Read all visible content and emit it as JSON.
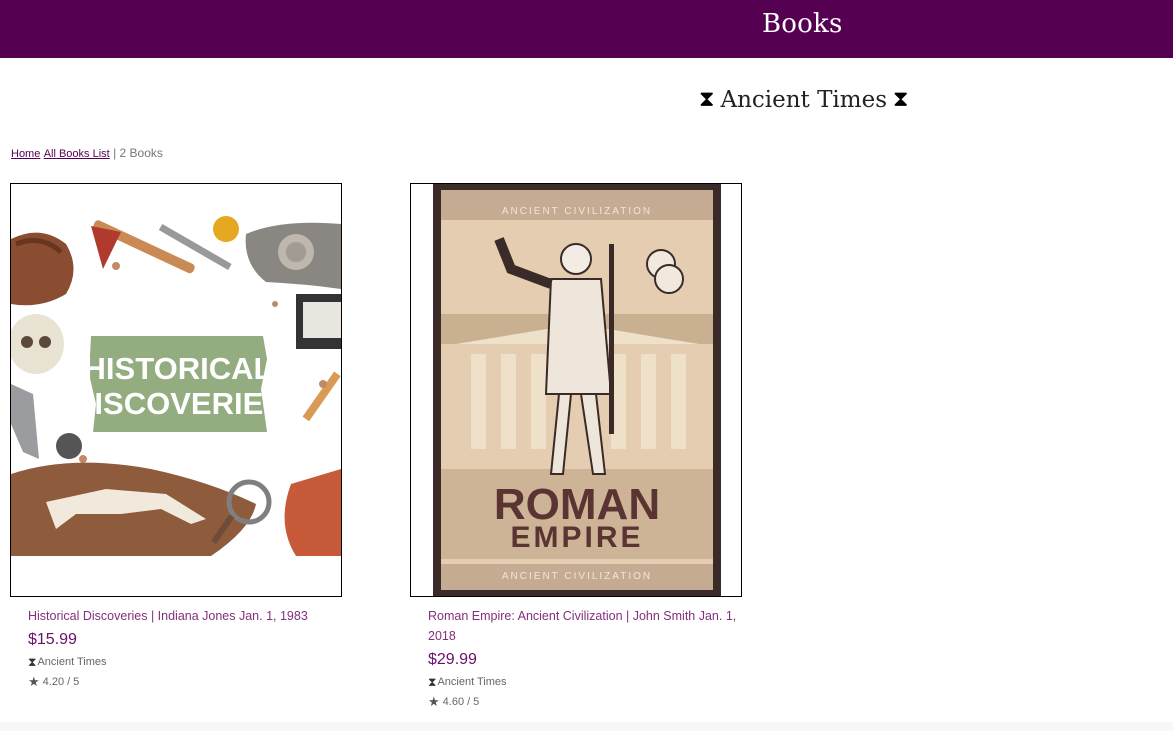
{
  "header": {
    "brand": "Books"
  },
  "category": {
    "title": "Ancient Times",
    "icon": "hourglass-icon"
  },
  "breadcrumb": {
    "home_link": "Home",
    "all_books_link": "All Books List",
    "separator": "|",
    "count": "2 Books"
  },
  "books": [
    {
      "title": "Historical Discoveries | Indiana Jones Jan. 1, 1983",
      "price": "$15.99",
      "category": "Ancient Times",
      "rating": "4.20",
      "rating_max": "5",
      "cover_text": [
        "HISTORICAL",
        "DISCOVERIES"
      ]
    },
    {
      "title": "Roman Empire: Ancient Civilization | John Smith Jan. 1, 2018",
      "price": "$29.99",
      "category": "Ancient Times",
      "rating": "4.60",
      "rating_max": "5",
      "cover_text": [
        "ANCIENT CIVILIZATION",
        "ROMAN",
        "EMPIRE",
        "ANCIENT CIVILIZATION"
      ]
    }
  ],
  "colors": {
    "brand": "#560052",
    "accent": "#84307e",
    "price": "#6b0f69"
  }
}
